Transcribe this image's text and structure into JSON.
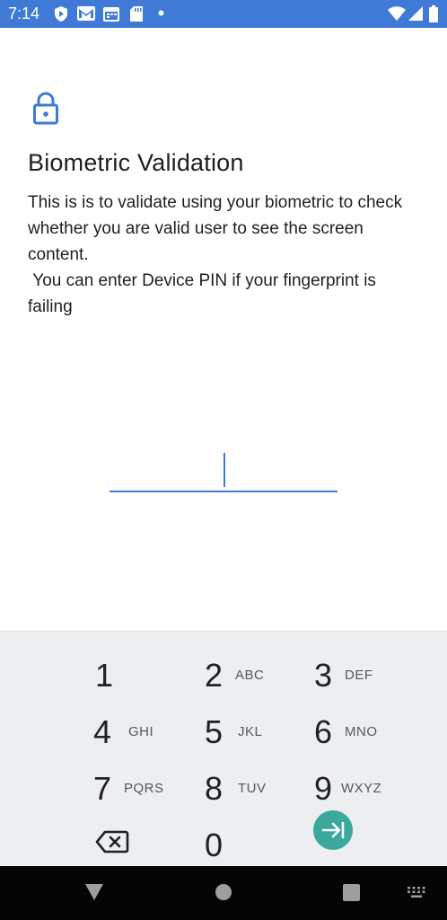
{
  "status_bar": {
    "time": "7:14",
    "left_icons": [
      "play-protect-icon",
      "gmail-icon",
      "calendar-icon",
      "sd-card-icon",
      "notification-dot-icon"
    ],
    "right_icons": [
      "wifi-icon",
      "cellular-signal-icon",
      "battery-icon"
    ],
    "background": "#3f7bd6"
  },
  "content": {
    "lock_icon": "lock-icon",
    "title": "Biometric Validation",
    "description": "This is is to validate using your biometric to check whether you are valid user to see the screen content.\n You can enter Device PIN if your fingerprint is failing",
    "pin_value": "",
    "accent_color": "#3f7bd6"
  },
  "keypad": {
    "keys": [
      {
        "digit": "1",
        "letters": ""
      },
      {
        "digit": "2",
        "letters": "ABC"
      },
      {
        "digit": "3",
        "letters": "DEF"
      },
      {
        "digit": "4",
        "letters": "GHI"
      },
      {
        "digit": "5",
        "letters": "JKL"
      },
      {
        "digit": "6",
        "letters": "MNO"
      },
      {
        "digit": "7",
        "letters": "PQRS"
      },
      {
        "digit": "8",
        "letters": "TUV"
      },
      {
        "digit": "9",
        "letters": "WXYZ"
      },
      {
        "digit": "0",
        "letters": ""
      }
    ],
    "backspace_icon": "backspace-icon",
    "go_icon": "tab-next-icon",
    "go_color": "#3aa99c",
    "background": "#eceef0"
  },
  "nav_bar": {
    "buttons": [
      "back-triangle-icon",
      "home-circle-icon",
      "recents-square-icon",
      "keyboard-switch-icon"
    ]
  }
}
